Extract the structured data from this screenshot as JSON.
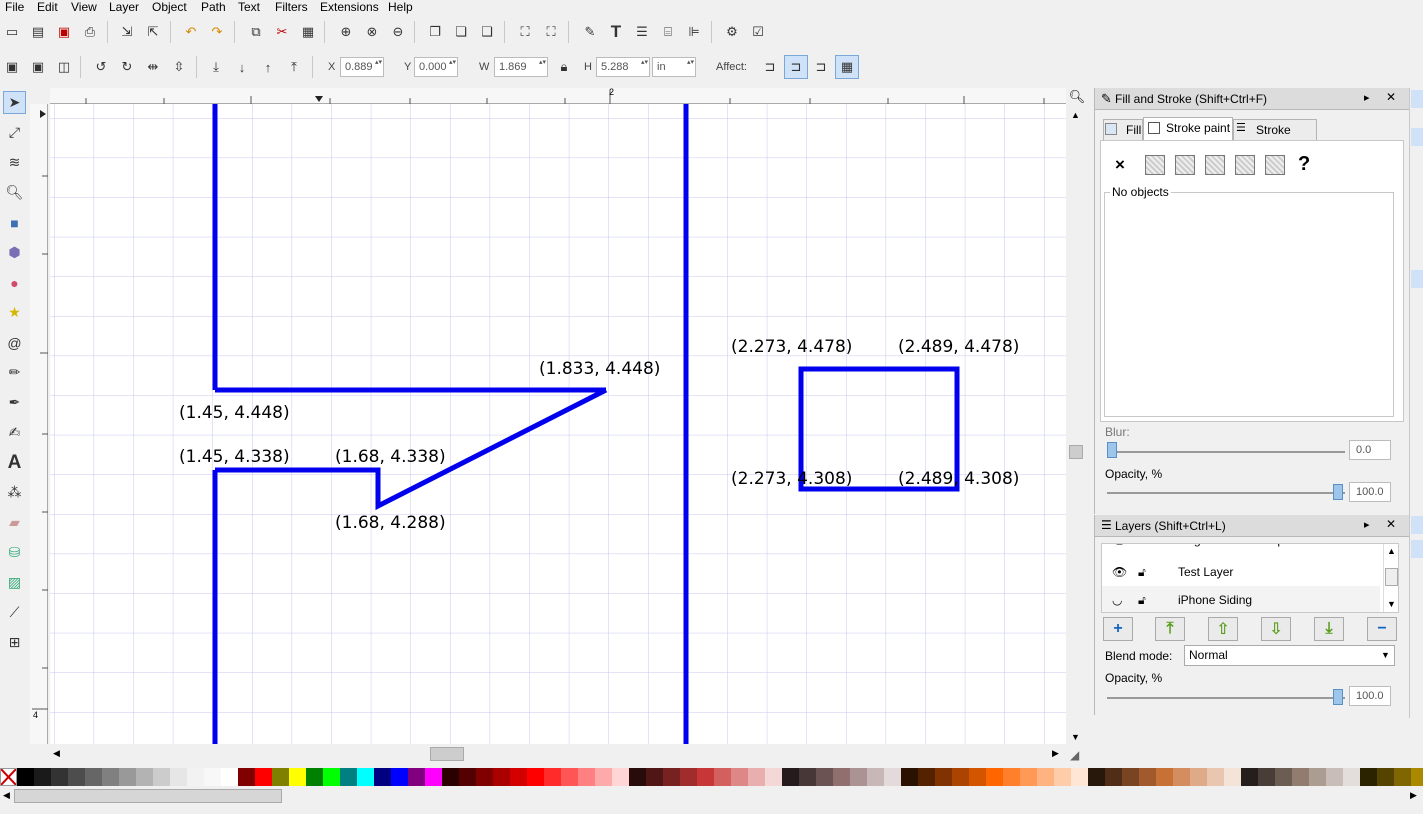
{
  "menu": [
    "File",
    "Edit",
    "View",
    "Layer",
    "Object",
    "Path",
    "Text",
    "Filters",
    "Extensions",
    "Help"
  ],
  "controls": {
    "x_label": "X",
    "x_value": "0.889",
    "y_label": "Y",
    "y_value": "0.000",
    "w_label": "W",
    "w_value": "1.869",
    "h_label": "H",
    "h_value": "5.288",
    "unit": "in",
    "affect_label": "Affect:"
  },
  "ruler": {
    "top_tick": "2",
    "left_tick": "4"
  },
  "canvas": {
    "labels": [
      "(1.833, 4.448)",
      "(1.45, 4.448)",
      "(1.45, 4.338)",
      "(1.68, 4.338)",
      "(1.68, 4.288)",
      "(2.273, 4.478)",
      "(2.489, 4.478)",
      "(2.273, 4.308)",
      "(2.489, 4.308)"
    ],
    "stroke_color": "#0000ee",
    "grid_color": "#c8c8f0"
  },
  "fill_stroke": {
    "title": "Fill and Stroke (Shift+Ctrl+F)",
    "tabs": [
      "Fill",
      "Stroke paint",
      "Stroke style"
    ],
    "paint_x": "×",
    "paint_unknown": "?",
    "no_objects": "No objects",
    "blur_label": "Blur:",
    "blur_value": "0.0",
    "opacity_label": "Opacity, %",
    "opacity_value": "100.0"
  },
  "layers": {
    "title": "Layers (Shift+Ctrl+L)",
    "rows": [
      "Original Box Bitmap",
      "Test Layer",
      "iPhone Siding"
    ],
    "blend_label": "Blend mode:",
    "blend_value": "Normal",
    "opacity_label": "Opacity, %",
    "opacity_value": "100.0"
  },
  "palette": [
    "#000000",
    "#1a1a1a",
    "#333333",
    "#4d4d4d",
    "#666666",
    "#808080",
    "#999999",
    "#b3b3b3",
    "#cccccc",
    "#e6e6e6",
    "#f2f2f2",
    "#f8f8f8",
    "#ffffff",
    "#800000",
    "#ff0000",
    "#808000",
    "#ffff00",
    "#008000",
    "#00ff00",
    "#008080",
    "#00ffff",
    "#000080",
    "#0000ff",
    "#800080",
    "#ff00ff",
    "#2b0000",
    "#550000",
    "#800000",
    "#aa0000",
    "#d40000",
    "#ff0000",
    "#ff2a2a",
    "#ff5555",
    "#ff8080",
    "#ffaaaa",
    "#ffd5d5",
    "#280b0b",
    "#501616",
    "#782121",
    "#a02c2c",
    "#c83737",
    "#d35f5f",
    "#de8787",
    "#e9afaf",
    "#f4d7d7",
    "#241c1c",
    "#483737",
    "#6c5353",
    "#916f6f",
    "#ac9393",
    "#c8b7b7",
    "#e3dbdb",
    "#2b1100",
    "#552200",
    "#803300",
    "#aa4400",
    "#d45500",
    "#ff6600",
    "#ff7f2a",
    "#ff9955",
    "#ffb380",
    "#ffccaa",
    "#ffe6d5",
    "#28170b",
    "#502d16",
    "#784421",
    "#a05a2c",
    "#c87137",
    "#d38d5f",
    "#deaa87",
    "#e9c6af",
    "#f4e3d7",
    "#241f1c",
    "#483e37",
    "#6c5d53",
    "#917c6f",
    "#ac9d93",
    "#c8beb7",
    "#e3dedb",
    "#2b2200",
    "#554400",
    "#806600",
    "#aa8800"
  ]
}
